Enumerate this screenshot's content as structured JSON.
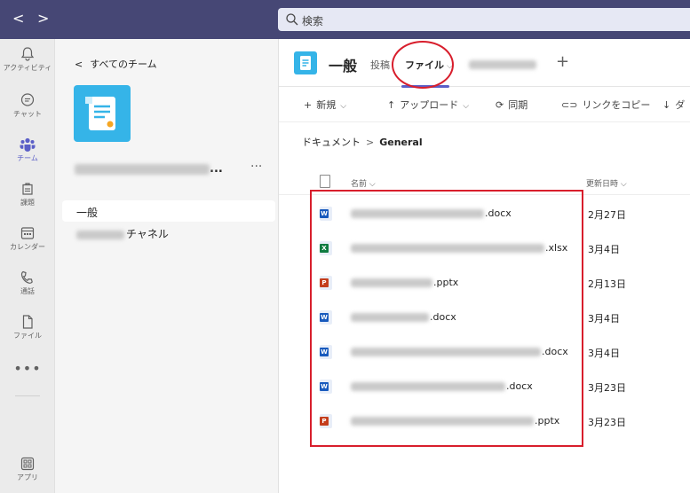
{
  "titlebar": {
    "back": "<",
    "forward": ">",
    "search_placeholder": "検索"
  },
  "appbar": {
    "items": [
      {
        "label": "アクティビティ",
        "icon": "bell-icon"
      },
      {
        "label": "チャット",
        "icon": "chat-icon"
      },
      {
        "label": "チーム",
        "icon": "teams-icon"
      },
      {
        "label": "課題",
        "icon": "assignments-icon"
      },
      {
        "label": "カレンダー",
        "icon": "calendar-icon"
      },
      {
        "label": "通話",
        "icon": "phone-icon"
      },
      {
        "label": "ファイル",
        "icon": "file-icon"
      },
      {
        "label": "アプリ",
        "icon": "apps-icon"
      }
    ],
    "more": "•••"
  },
  "team_panel": {
    "back_link": "すべてのチーム",
    "team_more": "···",
    "team_name_suffix": "...",
    "channels": [
      {
        "label": "一般"
      },
      {
        "label": "チャネル"
      }
    ]
  },
  "channel": {
    "title": "一般",
    "tabs": {
      "posts": "投稿",
      "files": "ファイル"
    },
    "add_tab": "+"
  },
  "toolbar": {
    "new": "新規",
    "upload": "アップロード",
    "sync": "同期",
    "copy_link": "リンクをコピー",
    "download": "ダ"
  },
  "breadcrumb": {
    "root": "ドキュメント",
    "current": "General"
  },
  "list": {
    "header_name": "名前",
    "header_modified": "更新日時"
  },
  "files": [
    {
      "ext": ".docx",
      "type": "word",
      "date": "2月27日"
    },
    {
      "ext": ".xlsx",
      "type": "excel",
      "date": "3月4日"
    },
    {
      "ext": ".pptx",
      "type": "powerpoint",
      "date": "2月13日"
    },
    {
      "ext": ".docx",
      "type": "word",
      "date": "3月4日"
    },
    {
      "ext": ".docx",
      "type": "word",
      "date": "3月4日"
    },
    {
      "ext": ".docx",
      "type": "word",
      "date": "3月23日"
    },
    {
      "ext": ".pptx",
      "type": "powerpoint",
      "date": "3月23日"
    }
  ],
  "colors": {
    "titlebar": "#464775",
    "accent": "#5b5fc7",
    "word": "#185abd",
    "excel": "#107c41",
    "powerpoint": "#c43e1c",
    "highlight_red": "#d81e2c"
  }
}
